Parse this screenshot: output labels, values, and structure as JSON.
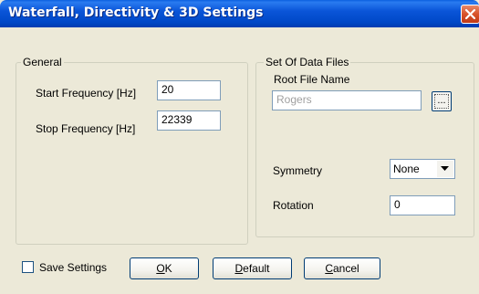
{
  "window": {
    "title": "Waterfall, Directivity & 3D Settings",
    "close_icon": "close-icon"
  },
  "general": {
    "legend": "General",
    "start_freq_label": "Start Frequency [Hz]",
    "start_freq_value": "20",
    "stop_freq_label": "Stop Frequency [Hz]",
    "stop_freq_value": "22339"
  },
  "data_files": {
    "legend": "Set Of Data Files",
    "root_label": "Root File Name",
    "root_value": "Rogers",
    "browse_label": "...",
    "symmetry_label": "Symmetry",
    "symmetry_value": "None",
    "rotation_label": "Rotation",
    "rotation_value": "0"
  },
  "footer": {
    "save_settings_label": "Save Settings",
    "save_settings_checked": false,
    "ok_first": "O",
    "ok_rest": "K",
    "default_first": "D",
    "default_rest": "efault",
    "cancel_first": "C",
    "cancel_rest": "ancel"
  }
}
